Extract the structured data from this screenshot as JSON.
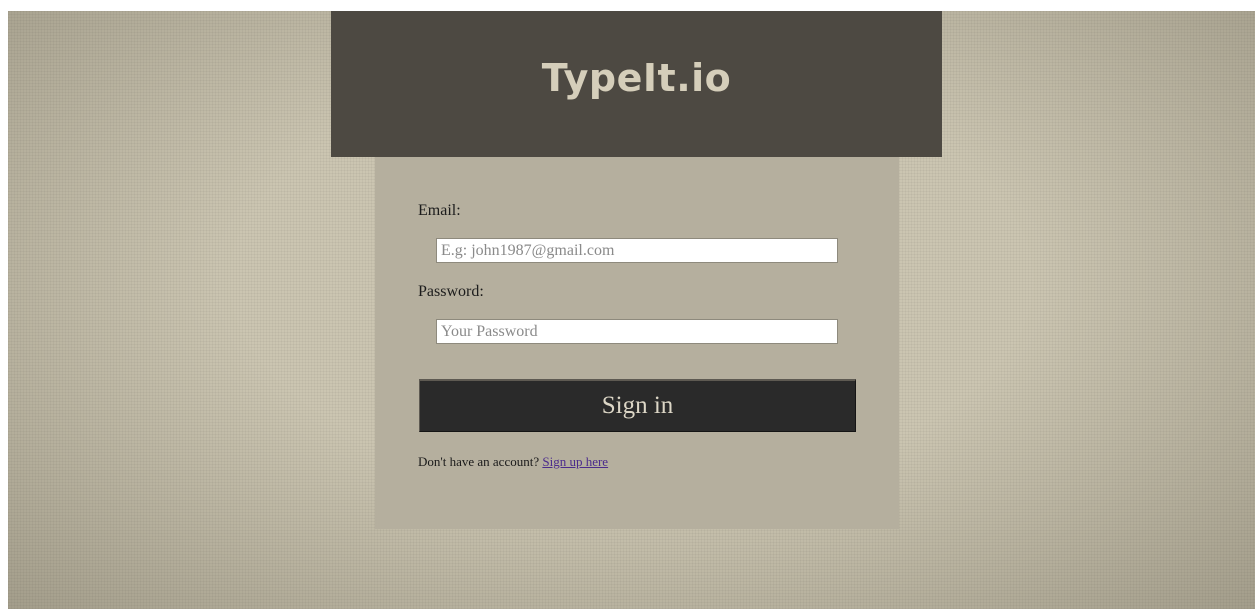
{
  "header": {
    "brand": "TypeIt.io"
  },
  "form": {
    "email": {
      "label": "Email:",
      "placeholder": "E.g: john1987@gmail.com",
      "value": ""
    },
    "password": {
      "label": "Password:",
      "placeholder": "Your Password",
      "value": ""
    },
    "submit_label": "Sign in"
  },
  "signup": {
    "prompt": "Don't have an account?",
    "link_label": "Sign up here"
  },
  "colors": {
    "background": "#cbc5b1",
    "header": "#4d4942",
    "brand_text": "#d5ceba",
    "card": "#b5af9e",
    "button": "#2a2a2a",
    "button_text": "#dcd6c6",
    "link": "#4b2b8c"
  }
}
